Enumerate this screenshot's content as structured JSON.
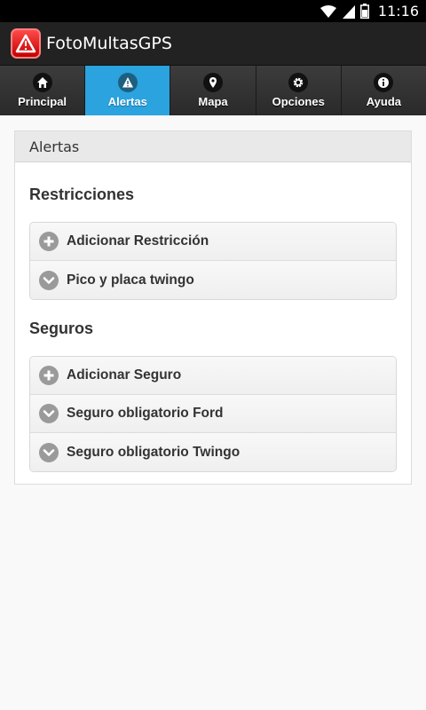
{
  "status_bar": {
    "time": "11:16"
  },
  "app": {
    "title": "FotoMultasGPS"
  },
  "tabs": [
    {
      "label": "Principal",
      "icon": "home-icon"
    },
    {
      "label": "Alertas",
      "icon": "warning-icon",
      "active": true
    },
    {
      "label": "Mapa",
      "icon": "map-pin-icon"
    },
    {
      "label": "Opciones",
      "icon": "gear-icon"
    },
    {
      "label": "Ayuda",
      "icon": "info-icon"
    }
  ],
  "colors": {
    "active_tab": "#2aa3de",
    "action_bar": "#222222",
    "logo_red": "#e00000"
  },
  "panel": {
    "header": "Alertas",
    "restricciones": {
      "title": "Restricciones",
      "items": [
        {
          "label": "Adicionar Restricción",
          "icon": "plus-circle-icon"
        },
        {
          "label": "Pico y placa twingo",
          "icon": "chevron-down-circle-icon"
        }
      ]
    },
    "seguros": {
      "title": "Seguros",
      "items": [
        {
          "label": "Adicionar Seguro",
          "icon": "plus-circle-icon"
        },
        {
          "label": "Seguro obligatorio Ford",
          "icon": "chevron-down-circle-icon"
        },
        {
          "label": "Seguro obligatorio Twingo",
          "icon": "chevron-down-circle-icon"
        }
      ]
    }
  }
}
